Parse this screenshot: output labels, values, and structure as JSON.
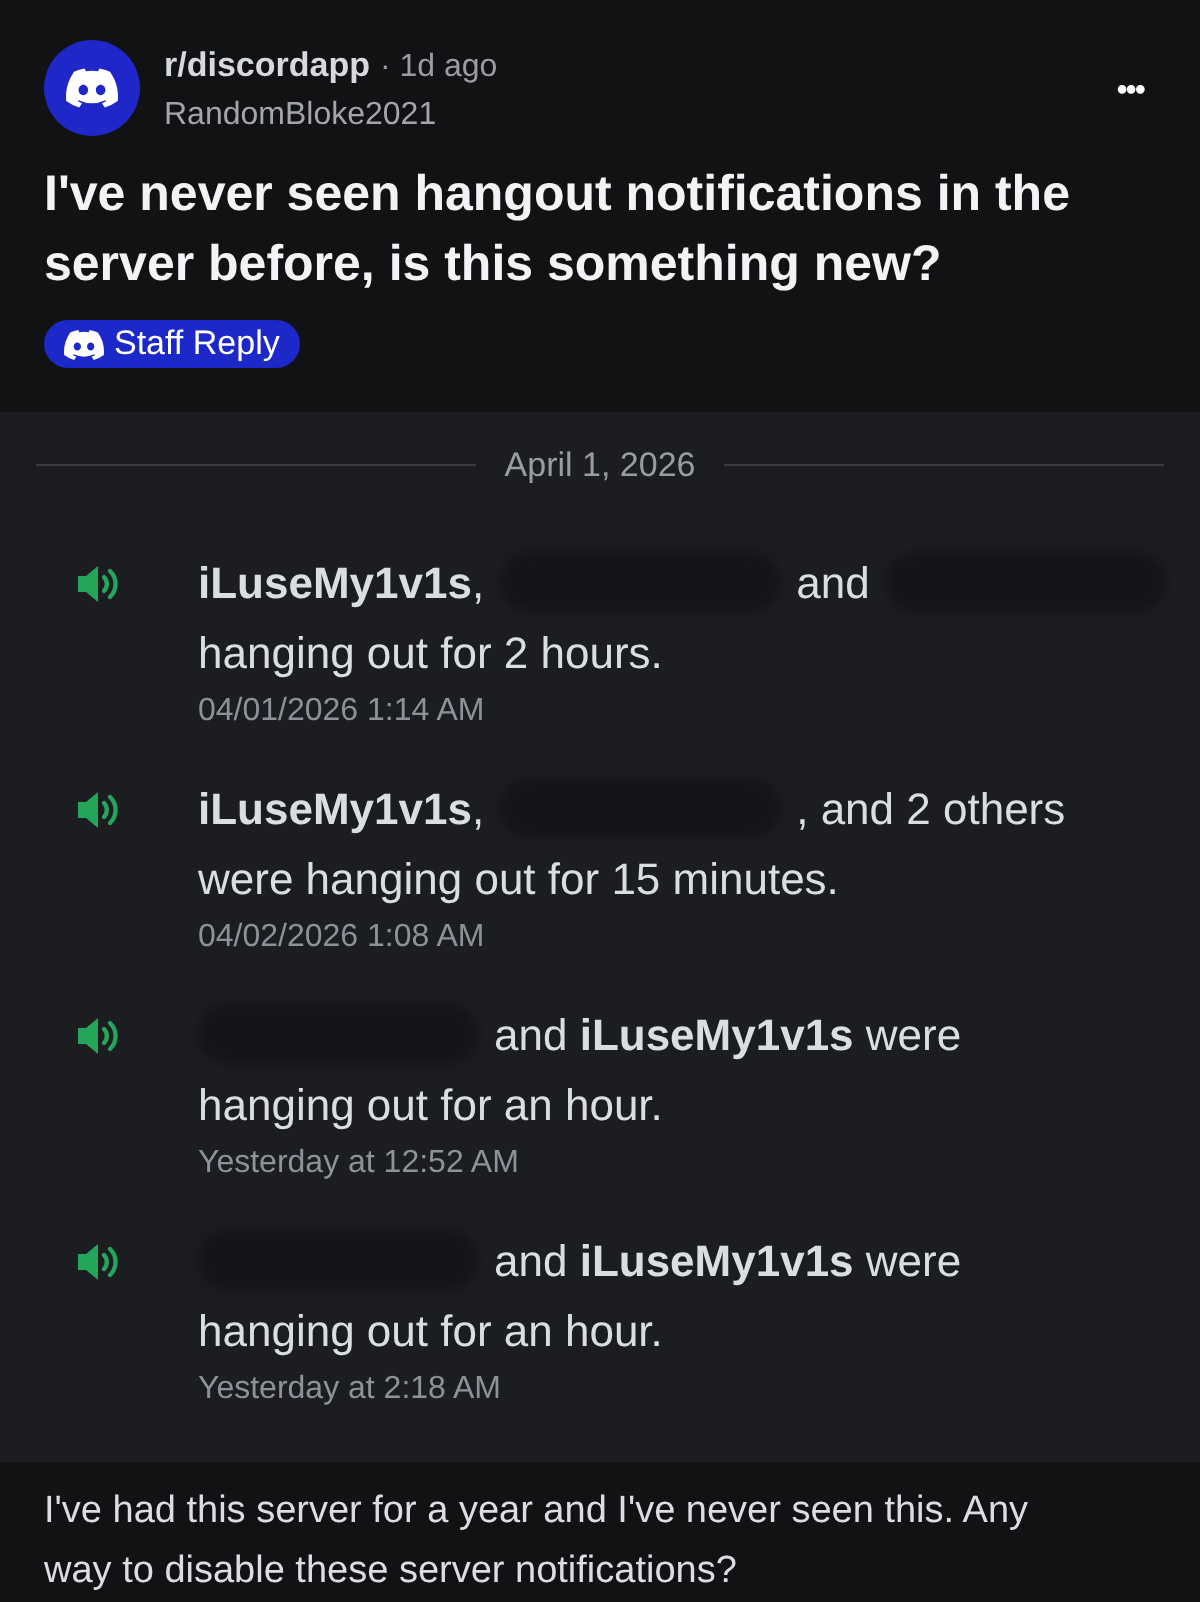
{
  "post": {
    "subreddit": "r/discordapp",
    "age": "· 1d ago",
    "author": "RandomBloke2021",
    "more": "•••",
    "title": "I've never seen hangout notifications in the server before, is this something new?",
    "badge": "Staff Reply"
  },
  "chat": {
    "date": "April 1, 2026",
    "messages": [
      {
        "line1": [
          {
            "kind": "text",
            "text": "**iLuseMy1v1s**,"
          },
          {
            "kind": "redacted"
          },
          {
            "kind": "text",
            "text": "and"
          },
          {
            "kind": "redacted"
          }
        ],
        "line2": "hanging out for 2 hours.",
        "time": "04/01/2026 1:14 AM"
      },
      {
        "line1": [
          {
            "kind": "text",
            "text": "**iLuseMy1v1s**,"
          },
          {
            "kind": "redacted"
          },
          {
            "kind": "text",
            "text": ", and 2 others"
          }
        ],
        "line2": "were hanging out for 15 minutes.",
        "time": "04/02/2026 1:08 AM"
      },
      {
        "line1": [
          {
            "kind": "redacted"
          },
          {
            "kind": "text",
            "text": "and **iLuseMy1v1s** were"
          }
        ],
        "line2": "hanging out for an hour.",
        "time": "Yesterday at 12:52 AM"
      },
      {
        "line1": [
          {
            "kind": "redacted"
          },
          {
            "kind": "text",
            "text": "and **iLuseMy1v1s** were"
          }
        ],
        "line2": "hanging out for an hour.",
        "time": "Yesterday at 2:18 AM"
      }
    ]
  },
  "comment": "I've had this server for a year and I've never seen this. Any way to disable these server notifications?"
}
